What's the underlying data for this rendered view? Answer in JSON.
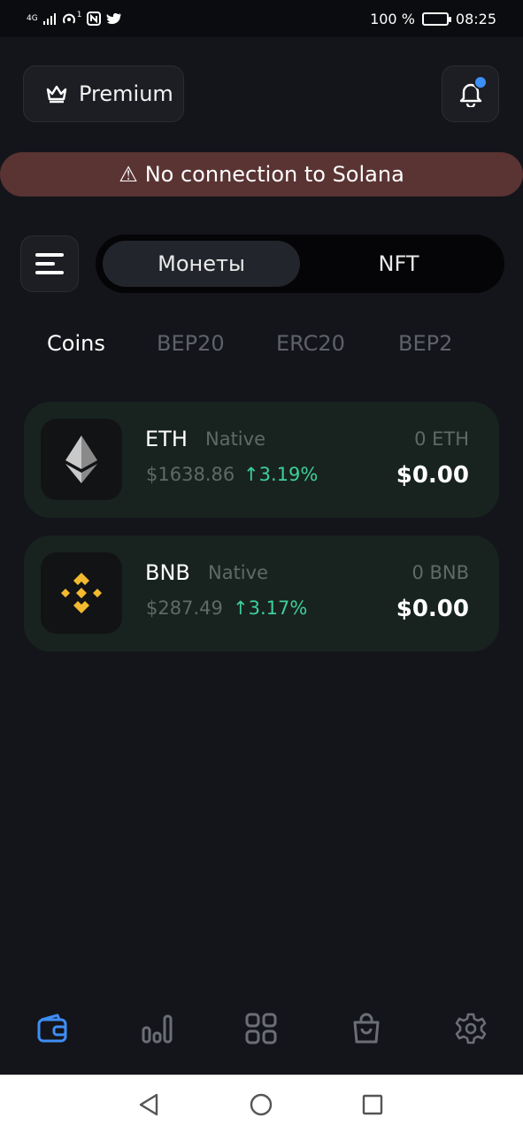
{
  "statusbar": {
    "network": "4G",
    "sim": "1",
    "battery_pct": "100 %",
    "time": "08:25",
    "icons": [
      "signal-icon",
      "hotspot-icon",
      "nfc-icon",
      "twitter-icon",
      "battery-icon"
    ]
  },
  "header": {
    "premium_label": "Premium",
    "premium_icon": "crown-icon",
    "notification_icon": "bell-icon",
    "notification_dot_color": "#3e8ef7"
  },
  "banner": {
    "icon": "⚠",
    "text": "No connection to Solana",
    "color": "#5a3333"
  },
  "segment": {
    "options": [
      "Монеты",
      "NFT"
    ],
    "selected": "Монеты"
  },
  "tabs": {
    "items": [
      "Coins",
      "BEP20",
      "ERC20",
      "BEP2"
    ],
    "active": "Coins"
  },
  "coins": [
    {
      "symbol": "ETH",
      "tag": "Native",
      "price": "$1638.86",
      "change": "3.19%",
      "change_direction": "up",
      "amount": "0 ETH",
      "value": "$0.00",
      "icon": "ethereum-icon"
    },
    {
      "symbol": "BNB",
      "tag": "Native",
      "price": "$287.49",
      "change": "3.17%",
      "change_direction": "up",
      "amount": "0 BNB",
      "value": "$0.00",
      "icon": "binance-icon"
    }
  ],
  "bottom_nav": {
    "items": [
      "wallet-icon",
      "chart-icon",
      "apps-icon",
      "shop-icon",
      "settings-icon"
    ],
    "active": "wallet-icon",
    "active_color": "#3e8ef7"
  },
  "system_nav": {
    "items": [
      "back-icon",
      "home-icon",
      "recents-icon"
    ]
  },
  "colors": {
    "background": "#14151a",
    "card": "#18231f",
    "positive": "#3ecf9b"
  }
}
